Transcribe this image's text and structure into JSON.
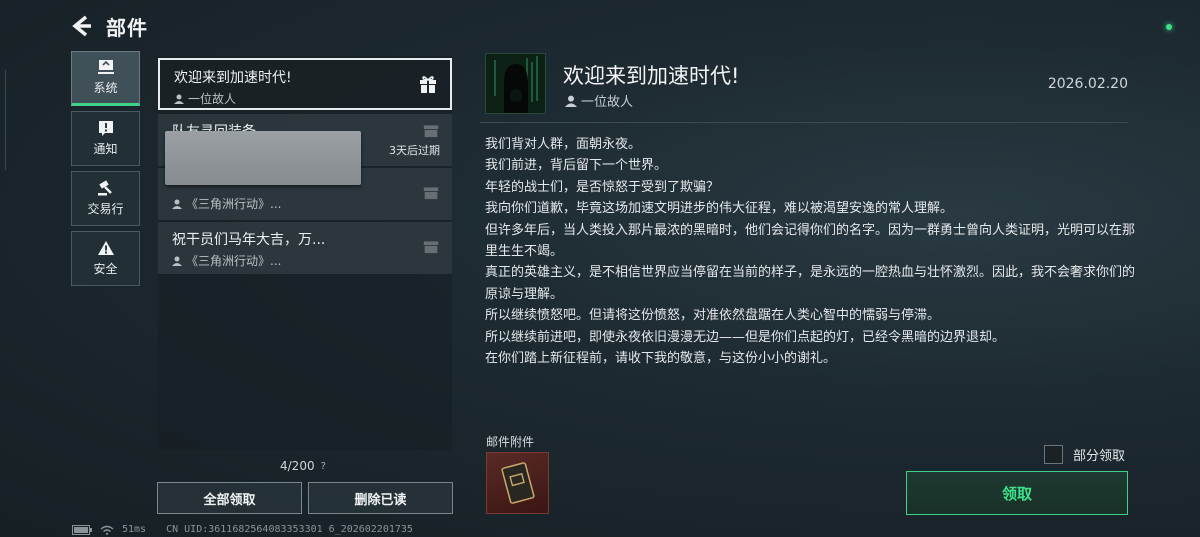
{
  "header": {
    "title": "部件"
  },
  "categories": [
    {
      "label": "系统",
      "icon": "monitor-icon"
    },
    {
      "label": "通知",
      "icon": "alert-icon"
    },
    {
      "label": "交易行",
      "icon": "hammer-icon"
    },
    {
      "label": "安全",
      "icon": "warning-icon"
    }
  ],
  "mails": [
    {
      "subject": "欢迎来到加速时代!",
      "sender": "一位故人",
      "expire": ""
    },
    {
      "subject": "队友寻回装备",
      "sender": "",
      "expire": "3天后过期"
    },
    {
      "subject": "",
      "sender": "《三角洲行动》...",
      "expire": ""
    },
    {
      "subject": "祝干员们马年大吉，万...",
      "sender": "《三角洲行动》...",
      "expire": ""
    }
  ],
  "list_footer": {
    "count": "4/200",
    "help": "?"
  },
  "actions": {
    "claim_all": "全部领取",
    "delete_read": "删除已读"
  },
  "status_bar": {
    "ping": "51ms",
    "uid": "CN UID:3611682564083353301 6_202602201735"
  },
  "detail": {
    "title": "欢迎来到加速时代!",
    "sender": "一位故人",
    "date": "2026.02.20",
    "paragraphs": [
      "我们背对人群，面朝永夜。",
      "我们前进，背后留下一个世界。",
      "年轻的战士们，是否惊怒于受到了欺骗？",
      "我向你们道歉，毕竟这场加速文明进步的伟大征程，难以被渴望安逸的常人理解。",
      "但许多年后，当人类投入那片最浓的黑暗时，他们会记得你们的名字。因为一群勇士曾向人类证明，光明可以在那里生生不竭。",
      "真正的英雄主义，是不相信世界应当停留在当前的样子，是永远的一腔热血与壮怀激烈。因此，我不会奢求你们的原谅与理解。",
      "所以继续愤怒吧。但请将这份愤怒，对准依然盘踞在人类心智中的懦弱与停滞。",
      "所以继续前进吧，即使永夜依旧漫漫无边——但是你们点起的灯，已经令黑暗的边界退却。",
      "在你们踏上新征程前，请收下我的敬意，与这份小小的谢礼。"
    ],
    "attachments_label": "邮件附件",
    "partial_claim_label": "部分领取",
    "claim_label": "领取"
  },
  "colors": {
    "accent": "#3fe08a",
    "background": "#1d2a31"
  }
}
